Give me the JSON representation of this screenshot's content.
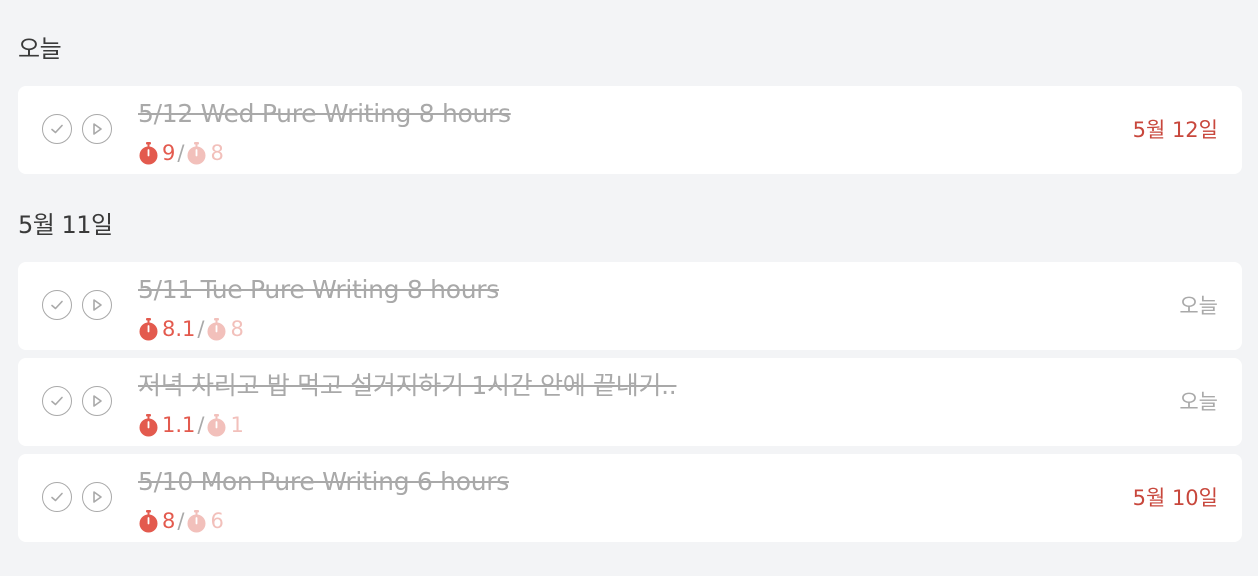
{
  "sections": [
    {
      "title": "오늘",
      "tasks": [
        {
          "title": "5/12 Wed Pure Writing 8 hours",
          "pomo_actual": "9",
          "pomo_separator": "/",
          "pomo_estimated": "8",
          "due": "5월 12일",
          "due_color": "#c8473c"
        }
      ]
    },
    {
      "title": "5월 11일",
      "tasks": [
        {
          "title": "5/11 Tue Pure Writing 8 hours",
          "pomo_actual": "8.1",
          "pomo_separator": "/",
          "pomo_estimated": "8",
          "due": "오늘",
          "due_color": "#a9a9a9"
        },
        {
          "title": "저녁 차리고 밥 먹고 설거지하기 1시간 안에 끝내기..",
          "pomo_actual": "1.1",
          "pomo_separator": "/",
          "pomo_estimated": "1",
          "due": "오늘",
          "due_color": "#a9a9a9"
        },
        {
          "title": "5/10 Mon Pure Writing 6 hours",
          "pomo_actual": "8",
          "pomo_separator": "/",
          "pomo_estimated": "6",
          "due": "5월 10일",
          "due_color": "#c8473c"
        }
      ]
    }
  ],
  "icons": {
    "complete": "check-circle-icon",
    "start": "play-circle-icon",
    "pomodoro": "tomato-timer-icon"
  },
  "colors": {
    "pomodoro_actual": "#e35a4e",
    "pomodoro_estimated": "#f2c0bb",
    "overdue": "#c8473c",
    "completed_text": "#a9a9a9",
    "background": "#f3f4f6"
  }
}
